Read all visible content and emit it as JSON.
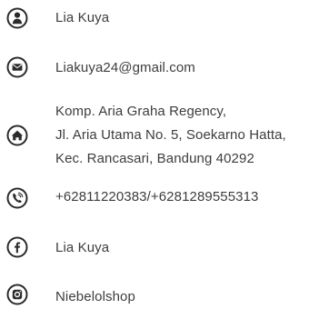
{
  "contact": {
    "name": "Lia Kuya",
    "email": "Liakuya24@gmail.com",
    "address": {
      "line1": "Komp. Aria Graha Regency,",
      "line2": "Jl. Aria Utama No. 5, Soekarno Hatta,",
      "line3": "Kec. Rancasari, Bandung 40292"
    },
    "phone": "+62811220383/+6281289555313",
    "facebook": "Lia Kuya",
    "instagram": "Niebelolshop"
  },
  "icons": {
    "person": "person-icon",
    "email": "envelope-icon",
    "home": "home-icon",
    "phone": "phone-icon",
    "facebook": "facebook-icon",
    "instagram": "instagram-icon"
  },
  "colors": {
    "icon": "#2b2b2b",
    "text": "#3d3d3d"
  }
}
